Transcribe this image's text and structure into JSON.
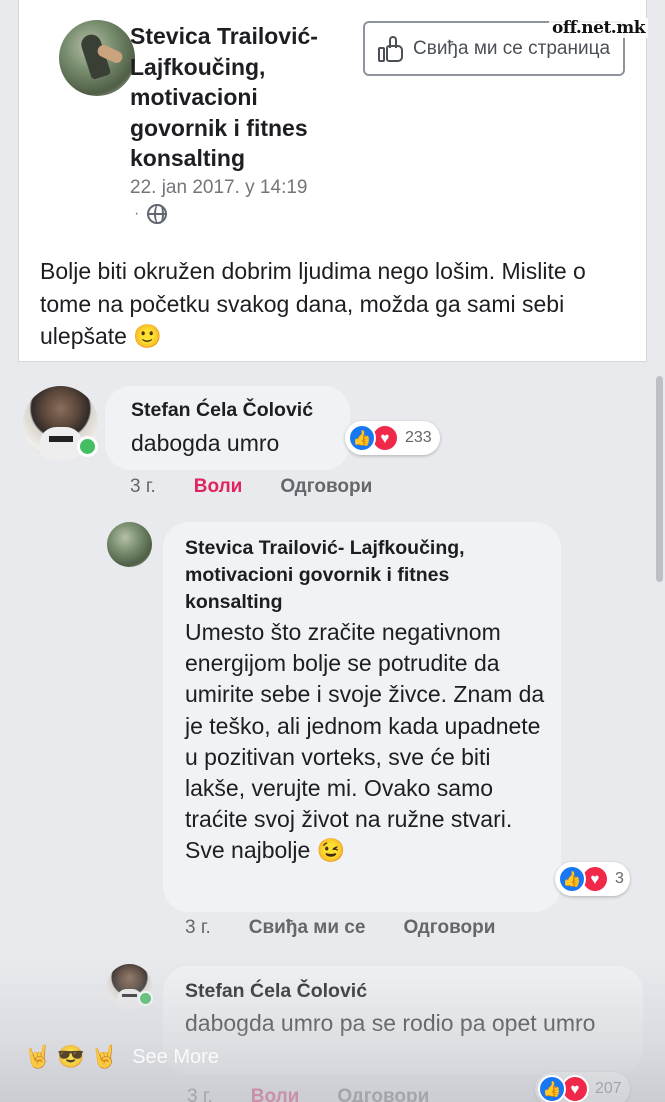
{
  "post": {
    "page_name": "Stevica Trailović- Lajfkoučing, motivacioni govornik i fitnes konsalting",
    "timestamp": "22. jan 2017. у 14:19",
    "privacy_separator": "·",
    "like_page_label": "Свиђа ми се страница",
    "text": "Bolje biti okružen dobrim ljudima nego lošim. Mislite o tome na početku svakog dana, možda ga sami sebi ulepšate 🙂"
  },
  "watermark": "off.net.mk",
  "comments": [
    {
      "author": "Stefan Ćela Čolović",
      "text": "dabogda umro",
      "reaction_count": "233",
      "time": "3 г.",
      "like_label": "Воли",
      "reply_label": "Одговори"
    },
    {
      "author": "Stevica Trailović- Lajfkoučing, motivacioni govornik i fitnes konsalting",
      "text": "Umesto što zračite negativnom energijom bolje se potrudite da umirite sebe i svoje živce. Znam da je teško, ali jednom kada upadnete u pozitivan vorteks, sve će biti lakše, verujte mi. Ovako samo traćite svoj život na ružne stvari. Sve najbolje 😉",
      "reaction_count": "3",
      "time": "3 г.",
      "like_label": "Свиђа ми се",
      "reply_label": "Одговори"
    },
    {
      "author": "Stefan Ćela Čolović",
      "text": "dabogda umro pa se rodio pa opet umro",
      "reaction_count": "207",
      "time": "3 г.",
      "like_label": "Воли",
      "reply_label": "Одговори"
    }
  ],
  "overlay": {
    "emojis": [
      "🤘",
      "😎",
      "🤘"
    ],
    "see_more": "See More"
  },
  "colors": {
    "like_blue": "#1877f2",
    "love_red": "#f02849",
    "liked_text": "#e0245e",
    "online_green": "#45bd62"
  },
  "icons": {
    "like_page": "thumbs-up-icon",
    "privacy": "globe-icon",
    "reaction_like": "like-reaction-icon",
    "reaction_love": "love-reaction-icon"
  }
}
